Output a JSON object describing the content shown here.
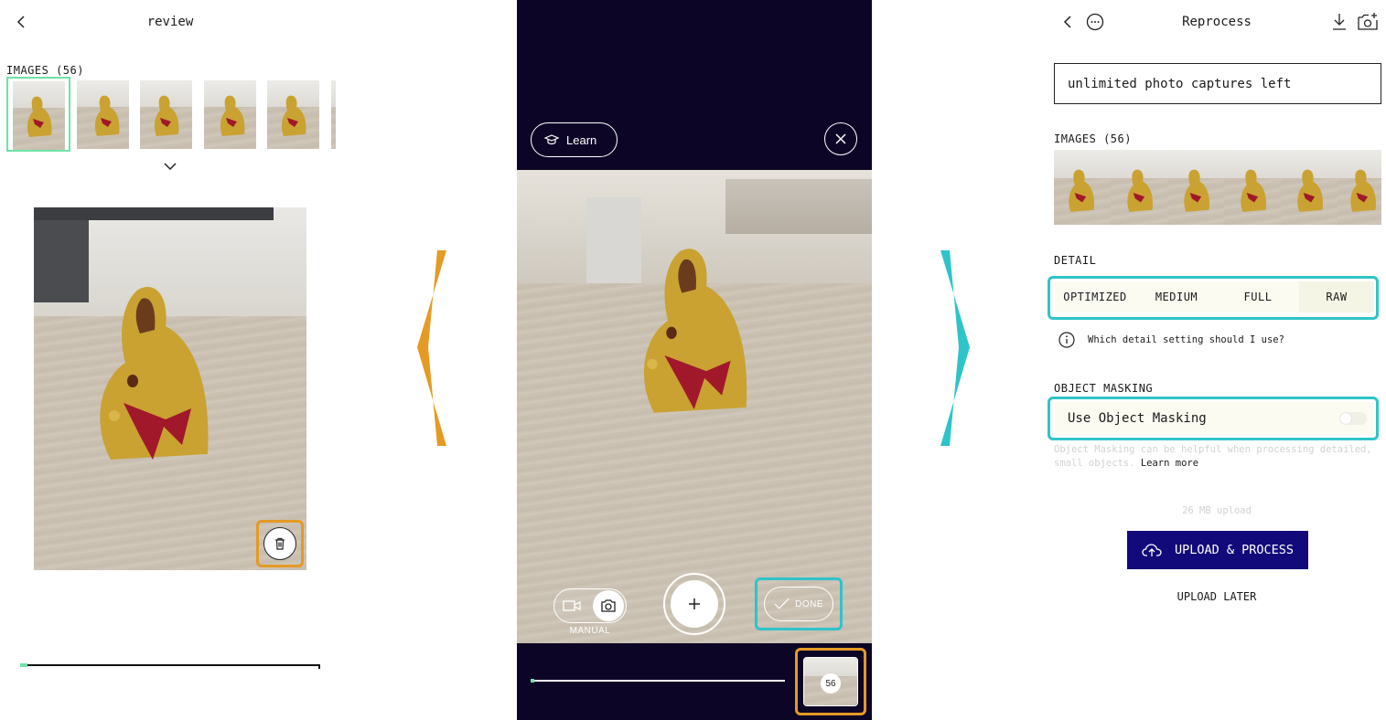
{
  "colors": {
    "accent_orange": "#e59a24",
    "accent_teal": "#2ec4c9",
    "accent_green": "#6ee3a7",
    "dark_bg": "#0d0526",
    "primary_button": "#120a7a"
  },
  "left": {
    "title": "review",
    "images_label": "IMAGES (56)",
    "icons": {
      "back": "chevron-left-icon",
      "expand": "chevron-down-icon",
      "delete": "trash-icon"
    }
  },
  "middle": {
    "learn_label": "Learn",
    "mode_label": "MANUAL",
    "done_label": "DONE",
    "capture_count": "56",
    "icons": {
      "learn": "graduation-cap-icon",
      "close": "close-icon",
      "video": "video-icon",
      "camera": "camera-icon",
      "capture": "plus-icon",
      "done": "checkmark-icon"
    }
  },
  "right": {
    "title": "Reprocess",
    "banner_text": "unlimited photo captures left",
    "images_label": "IMAGES (56)",
    "detail_label": "DETAIL",
    "detail_options": [
      "OPTIMIZED",
      "MEDIUM",
      "FULL",
      "RAW"
    ],
    "detail_selected": "RAW",
    "detail_help": "Which detail setting should I use?",
    "masking_label": "OBJECT MASKING",
    "masking_toggle_label": "Use Object Masking",
    "masking_enabled": false,
    "masking_help": "Object Masking can be helpful when processing detailed, small objects.",
    "learn_more": "Learn more",
    "upload_size": "26 MB upload",
    "upload_button": "UPLOAD & PROCESS",
    "upload_later": "UPLOAD LATER",
    "icons": {
      "back": "chevron-left-icon",
      "more": "more-icon",
      "download": "download-icon",
      "camera_add": "camera-icon"
    }
  }
}
